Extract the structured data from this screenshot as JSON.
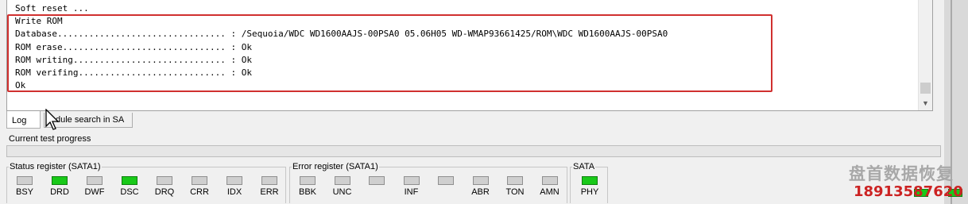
{
  "log": {
    "lines": [
      "Soft reset ...",
      "Write ROM",
      "Database................................ : /Sequoia/WDC WD1600AAJS-00PSA0 05.06H05 WD-WMAP93661425/ROM\\WDC WD1600AAJS-00PSA0",
      "ROM erase............................... : Ok",
      "ROM writing............................. : Ok",
      "ROM verifing............................ : Ok",
      "Ok"
    ]
  },
  "tabs": [
    {
      "label": "Log",
      "active": true
    },
    {
      "label": "Module search in SA",
      "visible_label": "dule search in SA",
      "active": false
    }
  ],
  "progress": {
    "label": "Current test progress",
    "value": 0
  },
  "status_register": {
    "title": "Status register (SATA1)",
    "leds": [
      {
        "label": "BSY",
        "on": false
      },
      {
        "label": "DRD",
        "on": true
      },
      {
        "label": "DWF",
        "on": false
      },
      {
        "label": "DSC",
        "on": true
      },
      {
        "label": "DRQ",
        "on": false
      },
      {
        "label": "CRR",
        "on": false
      },
      {
        "label": "IDX",
        "on": false
      },
      {
        "label": "ERR",
        "on": false
      }
    ]
  },
  "error_register": {
    "title": "Error register (SATA1)",
    "leds": [
      {
        "label": "BBK",
        "on": false
      },
      {
        "label": "UNC",
        "on": false
      },
      {
        "label": "",
        "on": false
      },
      {
        "label": "INF",
        "on": false
      },
      {
        "label": "",
        "on": false
      },
      {
        "label": "ABR",
        "on": false
      },
      {
        "label": "TON",
        "on": false
      },
      {
        "label": "AMN",
        "on": false
      }
    ]
  },
  "sata": {
    "title": "SATA",
    "leds": [
      {
        "label": "PHY",
        "on": true
      }
    ]
  },
  "watermark": {
    "logo_text": "盘首数据恢复",
    "phone": "18913587620"
  },
  "colors": {
    "led_on": "#19c919",
    "led_off": "#cfcfcf",
    "highlight": "#d0302f",
    "phone": "#cc2222"
  }
}
